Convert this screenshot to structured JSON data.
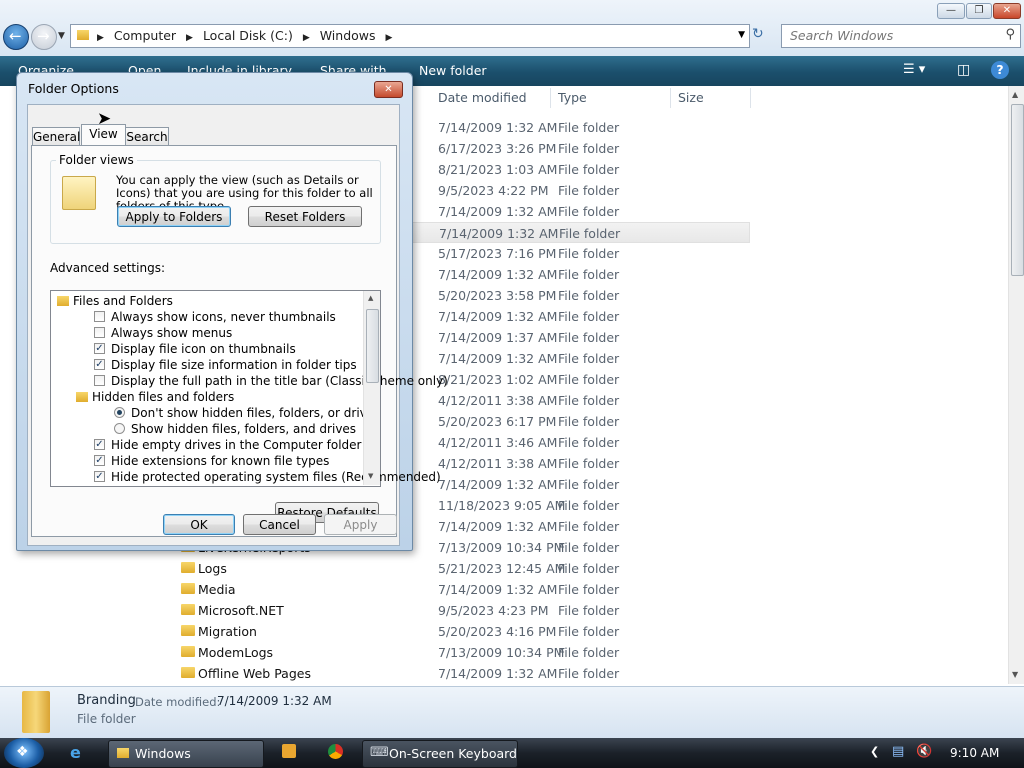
{
  "explorer": {
    "address": {
      "crumbs": [
        "Computer",
        "Local Disk (C:)",
        "Windows"
      ]
    },
    "search_placeholder": "Search Windows",
    "toolbar": {
      "organize": "Organize",
      "open": "Open",
      "include": "Include in library",
      "share": "Share with",
      "new_folder": "New folder"
    },
    "columns": {
      "date_modified": "Date modified",
      "type": "Type",
      "size": "Size"
    },
    "rows": [
      {
        "name": "",
        "date": "7/14/2009 1:32 AM",
        "type": "File folder"
      },
      {
        "name": "",
        "date": "6/17/2023 3:26 PM",
        "type": "File folder"
      },
      {
        "name": "",
        "date": "8/21/2023 1:03 AM",
        "type": "File folder"
      },
      {
        "name": "",
        "date": "9/5/2023 4:22 PM",
        "type": "File folder"
      },
      {
        "name": "",
        "date": "7/14/2009 1:32 AM",
        "type": "File folder"
      },
      {
        "name": "",
        "date": "7/14/2009 1:32 AM",
        "type": "File folder"
      },
      {
        "name": "",
        "date": "5/17/2023 7:16 PM",
        "type": "File folder"
      },
      {
        "name": "",
        "date": "7/14/2009 1:32 AM",
        "type": "File folder"
      },
      {
        "name": "",
        "date": "5/20/2023 3:58 PM",
        "type": "File folder"
      },
      {
        "name": "",
        "date": "7/14/2009 1:32 AM",
        "type": "File folder"
      },
      {
        "name": "",
        "date": "7/14/2009 1:37 AM",
        "type": "File folder"
      },
      {
        "name": "",
        "date": "7/14/2009 1:32 AM",
        "type": "File folder"
      },
      {
        "name": "",
        "date": "8/21/2023 1:02 AM",
        "type": "File folder"
      },
      {
        "name": "",
        "date": "4/12/2011 3:38 AM",
        "type": "File folder"
      },
      {
        "name": "",
        "date": "5/20/2023 6:17 PM",
        "type": "File folder"
      },
      {
        "name": "",
        "date": "4/12/2011 3:46 AM",
        "type": "File folder"
      },
      {
        "name": "",
        "date": "4/12/2011 3:38 AM",
        "type": "File folder"
      },
      {
        "name": "",
        "date": "7/14/2009 1:32 AM",
        "type": "File folder"
      },
      {
        "name": "",
        "date": "11/18/2023 9:05 AM",
        "type": "File folder"
      },
      {
        "name": "",
        "date": "7/14/2009 1:32 AM",
        "type": "File folder"
      },
      {
        "name": "LiveKernelReports",
        "date": "7/13/2009 10:34 PM",
        "type": "File folder"
      },
      {
        "name": "Logs",
        "date": "5/21/2023 12:45 AM",
        "type": "File folder"
      },
      {
        "name": "Media",
        "date": "7/14/2009 1:32 AM",
        "type": "File folder"
      },
      {
        "name": "Microsoft.NET",
        "date": "9/5/2023 4:23 PM",
        "type": "File folder"
      },
      {
        "name": "Migration",
        "date": "5/20/2023 4:16 PM",
        "type": "File folder"
      },
      {
        "name": "ModemLogs",
        "date": "7/13/2009 10:34 PM",
        "type": "File folder"
      },
      {
        "name": "Offline Web Pages",
        "date": "7/14/2009 1:32 AM",
        "type": "File folder"
      }
    ],
    "details": {
      "name": "Branding",
      "date_label": "Date modified:",
      "date_value": "7/14/2009 1:32 AM",
      "type": "File folder"
    }
  },
  "dialog": {
    "title": "Folder Options",
    "tabs": [
      "General",
      "View",
      "Search"
    ],
    "folder_views": {
      "label": "Folder views",
      "description": "You can apply the view (such as Details or Icons) that you are using for this folder to all folders of this type.",
      "apply_button": "Apply to Folders",
      "reset_button": "Reset Folders"
    },
    "advanced_label": "Advanced settings:",
    "advanced_items": [
      {
        "kind": "folder",
        "indent": 0,
        "label": "Files and Folders"
      },
      {
        "kind": "checkbox",
        "indent": 1,
        "checked": false,
        "label": "Always show icons, never thumbnails"
      },
      {
        "kind": "checkbox",
        "indent": 1,
        "checked": false,
        "label": "Always show menus"
      },
      {
        "kind": "checkbox",
        "indent": 1,
        "checked": true,
        "label": "Display file icon on thumbnails"
      },
      {
        "kind": "checkbox",
        "indent": 1,
        "checked": true,
        "label": "Display file size information in folder tips"
      },
      {
        "kind": "checkbox",
        "indent": 1,
        "checked": false,
        "label": "Display the full path in the title bar (Classic theme only)"
      },
      {
        "kind": "folder",
        "indent": 1,
        "label": "Hidden files and folders"
      },
      {
        "kind": "radio",
        "indent": 2,
        "checked": true,
        "label": "Don't show hidden files, folders, or drives"
      },
      {
        "kind": "radio",
        "indent": 2,
        "checked": false,
        "label": "Show hidden files, folders, and drives"
      },
      {
        "kind": "checkbox",
        "indent": 1,
        "checked": true,
        "label": "Hide empty drives in the Computer folder"
      },
      {
        "kind": "checkbox",
        "indent": 1,
        "checked": true,
        "label": "Hide extensions for known file types"
      },
      {
        "kind": "checkbox",
        "indent": 1,
        "checked": true,
        "label": "Hide protected operating system files (Recommended)"
      }
    ],
    "restore_button": "Restore Defaults",
    "ok_button": "OK",
    "cancel_button": "Cancel",
    "apply_button": "Apply"
  },
  "taskbar": {
    "items": [
      "Windows",
      "On-Screen Keyboard"
    ],
    "clock": "9:10 AM"
  }
}
